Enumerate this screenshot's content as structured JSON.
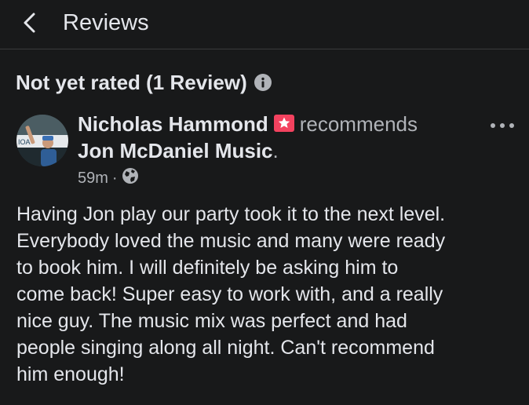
{
  "header": {
    "title": "Reviews"
  },
  "rating": {
    "title": "Not yet rated (1 Review)"
  },
  "review": {
    "author": "Nicholas Hammond",
    "action": "recommends",
    "page_name": "Jon McDaniel Music",
    "page_suffix": ".",
    "time": "59m",
    "separator": "·",
    "privacy_icon": "globe-icon",
    "body": "Having Jon play our party took it to the next level.\nEverybody loved the music and many were ready\nto book him.  I will definitely be asking him to\ncome back!  Super easy to work with, and a really\nnice guy. The music mix was perfect and had\npeople singing along all night. Can't recommend\nhim enough!"
  },
  "colors": {
    "background": "#18191a",
    "text_primary": "#e4e6eb",
    "text_secondary": "#b0b3b8",
    "recommend_badge": "#f3425f",
    "divider": "#3a3b3c"
  }
}
